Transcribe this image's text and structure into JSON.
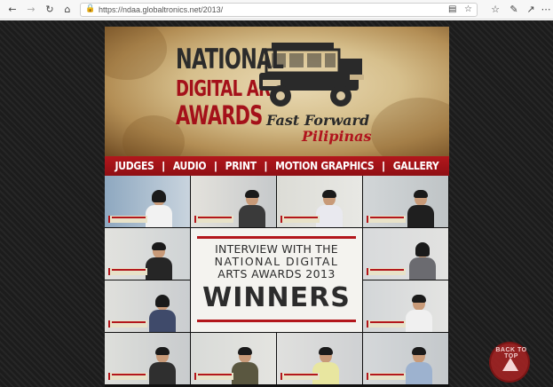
{
  "browser": {
    "url": "https://ndaa.globaltronics.net/2013/",
    "icons": [
      "back-arrow",
      "forward-arrow",
      "refresh",
      "home",
      "lock",
      "reading-view",
      "favorite-star",
      "favorites",
      "pen",
      "share",
      "more"
    ]
  },
  "banner": {
    "logo_line1": "NATIONAL",
    "logo_line2": "DIGITAL ARTS",
    "logo_line3": "AWARDS",
    "tagline1": "Fast Forward",
    "tagline2": "Pilipinas"
  },
  "nav": {
    "items": [
      "JUDGES",
      "AUDIO",
      "PRINT",
      "MOTION GRAPHICS",
      "GALLERY"
    ],
    "separator": "|"
  },
  "center_panel": {
    "line1": "INTERVIEW WITH THE",
    "line2": "NATIONAL DIGITAL",
    "line3": "ARTS AWARDS 2013",
    "line4": "WINNERS"
  },
  "back_to_top": "BACK TO TOP",
  "colors": {
    "accent_red": "#b3171c",
    "page_bg": "#1f1f1f"
  }
}
